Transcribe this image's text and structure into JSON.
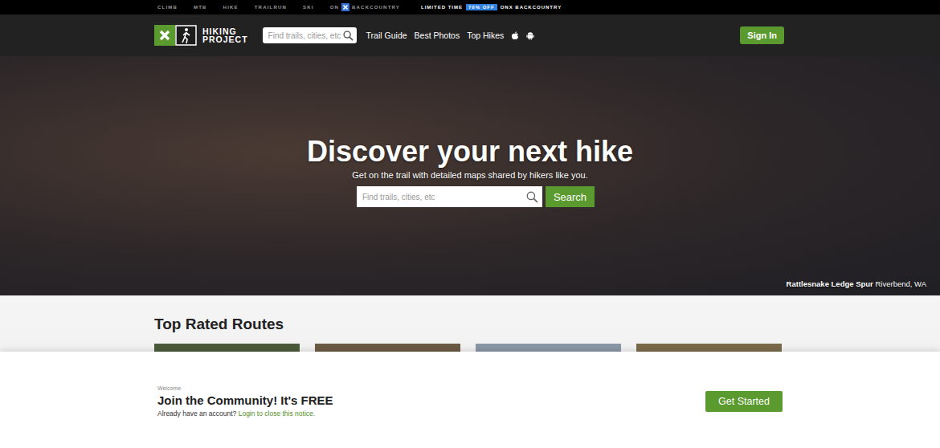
{
  "top_bar": {
    "links": [
      "CLIMB",
      "MTB",
      "HIKE",
      "TRAILRUN",
      "SKI"
    ],
    "onx": {
      "prefix": "ON",
      "suffix": "BACKCOUNTRY"
    },
    "promo": {
      "lead": "LIMITED TIME",
      "badge": "70% OFF",
      "tail": "ONX BACKCOUNTRY"
    }
  },
  "nav": {
    "logo": {
      "line1": "HIKING",
      "line2": "PROJECT"
    },
    "search": {
      "placeholder": "Find trails, cities, etc"
    },
    "links": [
      "Trail Guide",
      "Best Photos",
      "Top Hikes"
    ],
    "sign_in": "Sign In"
  },
  "hero": {
    "title": "Discover your next hike",
    "subtitle": "Get on the trail with detailed maps shared by hikers like you.",
    "search": {
      "placeholder": "Find trails, cities, etc",
      "button": "Search"
    },
    "caption": {
      "route": "Rattlesnake Ledge Spur",
      "place": "Riverbend, WA"
    }
  },
  "top_rated": {
    "title": "Top Rated Routes",
    "cards": [
      {
        "color": "#4a5a3a"
      },
      {
        "color": "#6b5a44"
      },
      {
        "color": "#8a97a6"
      },
      {
        "color": "#7a6a4a"
      }
    ]
  },
  "banner": {
    "eyebrow": "Welcome",
    "title": "Join the Community! It's FREE",
    "note": "Already have an account?",
    "login": "Login to close this notice.",
    "button": "Get Started"
  }
}
